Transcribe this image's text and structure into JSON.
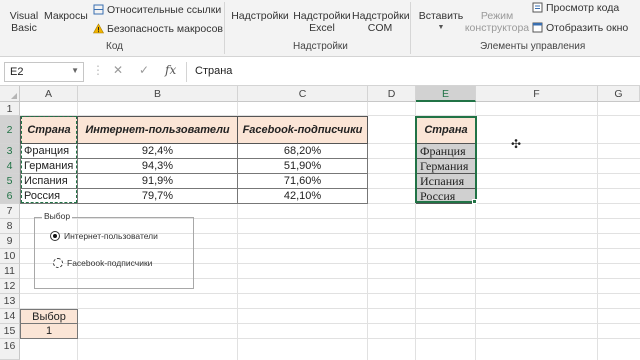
{
  "ribbon": {
    "vba_label": "Visual\nBasic",
    "macros_label": "Макросы",
    "relative_refs": "Относительные ссылки",
    "macro_security": "Безопасность макросов",
    "code_group": "Код",
    "addins_label": "Надстройки",
    "excel_addins_label": "Надстройки\nExcel",
    "com_addins_label": "Надстройки\nCOM",
    "addins_group": "Надстройки",
    "insert_label": "Вставить",
    "design_mode_label": "Режим\nконструктора",
    "view_code": "Просмотр кода",
    "show_window": "Отобразить окно",
    "controls_group": "Элементы управления"
  },
  "formula_bar": {
    "name_box": "E2",
    "fx_label": "fx",
    "content": "Страна"
  },
  "columns": [
    "A",
    "B",
    "C",
    "D",
    "E",
    "F",
    "G"
  ],
  "rows": [
    "1",
    "2",
    "3",
    "4",
    "5",
    "6",
    "7",
    "8",
    "9",
    "10",
    "11",
    "12",
    "13",
    "14",
    "15",
    "16"
  ],
  "table": {
    "headers": [
      "Страна",
      "Интернет-пользователи",
      "Facebook-подписчики"
    ],
    "rows": [
      [
        "Франция",
        "92,4%",
        "68,20%"
      ],
      [
        "Германия",
        "94,3%",
        "51,90%"
      ],
      [
        "Испания",
        "91,9%",
        "71,60%"
      ],
      [
        "Россия",
        "79,7%",
        "42,10%"
      ]
    ]
  },
  "e_list": {
    "header": "Страна",
    "items": [
      "Франция",
      "Германия",
      "Испания",
      "Россия"
    ]
  },
  "groupbox": {
    "title": "Выбор",
    "option1": "Интернет-пользователи",
    "option2": "Facebook-подписчики",
    "selected_option": 1
  },
  "choice": {
    "label": "Выбор",
    "value": "1"
  },
  "colors": {
    "header_fill": "#fbe5d6",
    "selection": "#217346",
    "e_fill": "#d0d0d0"
  }
}
